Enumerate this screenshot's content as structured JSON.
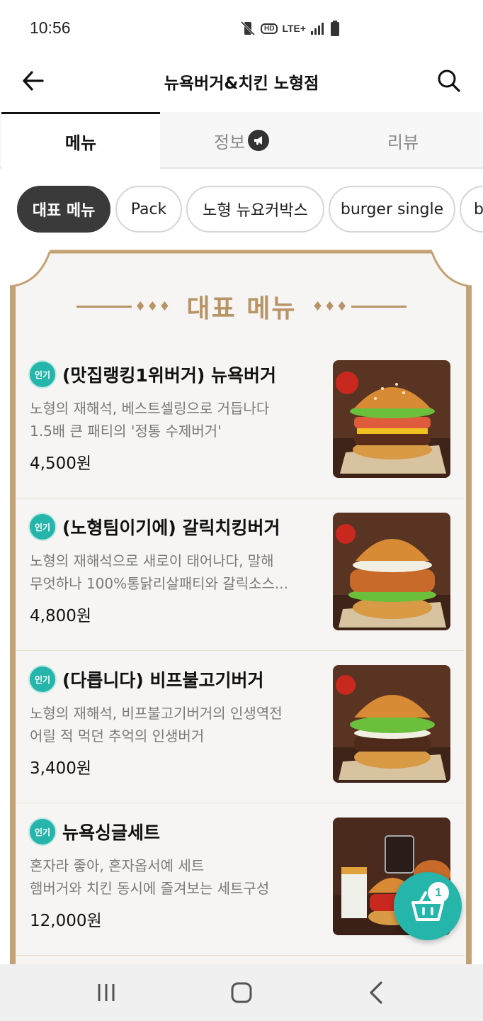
{
  "status": {
    "time": "10:56",
    "hd_label": "HD",
    "lte_label": "LTE+"
  },
  "header": {
    "title": "뉴욕버거&치킨 노형점"
  },
  "tabs": [
    {
      "label": "메뉴"
    },
    {
      "label": "정보"
    },
    {
      "label": "리뷰"
    }
  ],
  "chips": [
    {
      "label": "대표 메뉴"
    },
    {
      "label": "Pack"
    },
    {
      "label": "노형 뉴요커박스"
    },
    {
      "label": "burger single"
    },
    {
      "label": "b"
    }
  ],
  "board": {
    "title": "대표 메뉴",
    "ornament": "♦♦♦"
  },
  "menu_items": [
    {
      "badge": "인기",
      "title": "(맛집랭킹1위버거) 뉴욕버거",
      "desc_1": "노형의 재해석, 베스트셀링으로 거듭나다",
      "desc_2": "1.5배 큰 패티의 '정통 수제버거'",
      "price": "4,500원"
    },
    {
      "badge": "인기",
      "title": "(노형팀이기에) 갈릭치킹버거",
      "desc_1": "노형의 재해석으로 새로이 태어나다, 말해",
      "desc_2": "무엇하나 100%통닭리살패티와 갈릭소스...",
      "price": "4,800원"
    },
    {
      "badge": "인기",
      "title": "(다릅니다) 비프불고기버거",
      "desc_1": "노형의 재해석, 비프불고기버거의 인생역전",
      "desc_2": "어릴 적 먹던 추억의 인생버거",
      "price": "3,400원"
    },
    {
      "badge": "인기",
      "title": "뉴욕싱글세트",
      "desc_1": "혼자라 좋아, 혼자옵서예 세트",
      "desc_2": "햄버거와 치킨 동시에 즐겨보는 세트구성",
      "price": "12,000원"
    }
  ],
  "cart": {
    "count": "1"
  },
  "colors": {
    "accent": "#26b5aa",
    "board_border": "#c3a275",
    "board_title": "#b89466",
    "active_chip": "#3a3a3a"
  }
}
